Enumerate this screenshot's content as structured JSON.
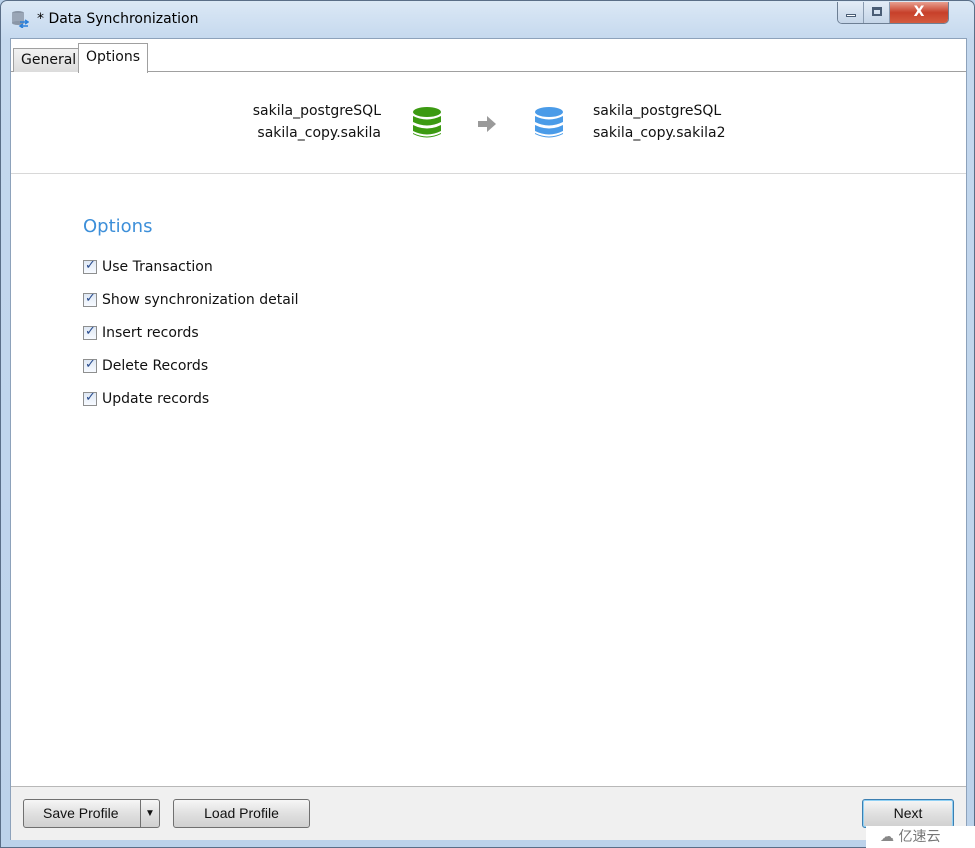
{
  "window": {
    "title": "* Data Synchronization",
    "close_glyph": "X",
    "controls": [
      "minimize",
      "maximize",
      "close"
    ]
  },
  "tabs": [
    {
      "label": "General",
      "active": false
    },
    {
      "label": "Options",
      "active": true
    }
  ],
  "source": {
    "connection": "sakila_postgreSQL",
    "schema": "sakila_copy.sakila",
    "icon": "database-icon",
    "color": "#3c9a12"
  },
  "target": {
    "connection": "sakila_postgreSQL",
    "schema": "sakila_copy.sakila2",
    "icon": "database-icon",
    "color": "#4a9be8"
  },
  "options": {
    "heading": "Options",
    "items": [
      {
        "label": "Use Transaction",
        "checked": true
      },
      {
        "label": "Show synchronization detail",
        "checked": true
      },
      {
        "label": "Insert records",
        "checked": true
      },
      {
        "label": "Delete Records",
        "checked": true
      },
      {
        "label": "Update records",
        "checked": true
      }
    ]
  },
  "footer": {
    "save_profile": "Save Profile",
    "load_profile": "Load Profile",
    "next": "Next"
  },
  "watermark": "亿速云"
}
